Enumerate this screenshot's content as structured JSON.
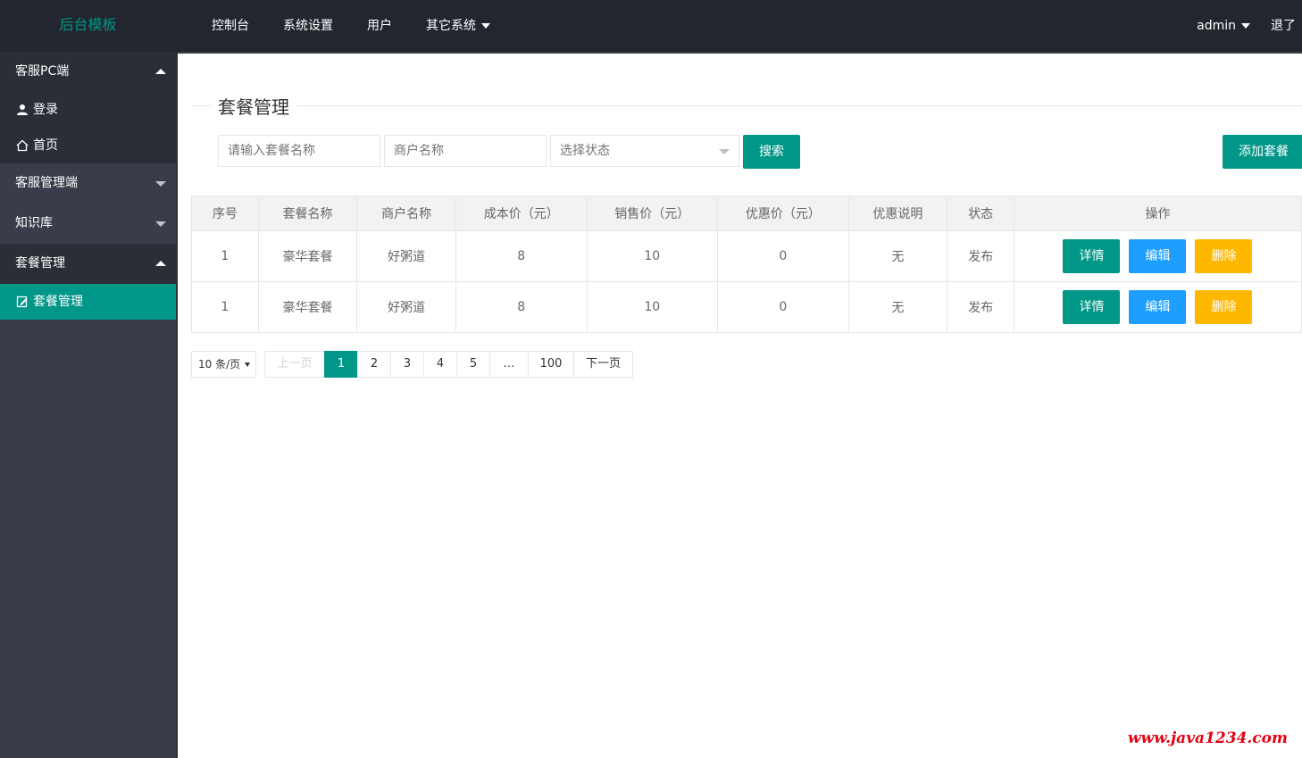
{
  "header": {
    "logo": "后台模板",
    "nav": [
      "控制台",
      "系统设置",
      "用户",
      "其它系统"
    ],
    "user": "admin",
    "logout": "退了"
  },
  "sidebar": {
    "groups": [
      {
        "title": "客服PC端",
        "expanded": true,
        "items": [
          {
            "label": "登录",
            "icon": "user-icon"
          },
          {
            "label": "首页",
            "icon": "home-icon"
          }
        ]
      },
      {
        "title": "客服管理端",
        "expanded": false
      },
      {
        "title": "知识库",
        "expanded": false
      },
      {
        "title": "套餐管理",
        "expanded": true,
        "items": [
          {
            "label": "套餐管理",
            "icon": "edit-icon",
            "selected": true
          }
        ]
      }
    ]
  },
  "main": {
    "title": "套餐管理",
    "search": {
      "package_placeholder": "请输入套餐名称",
      "merchant_placeholder": "商户名称",
      "status_placeholder": "选择状态",
      "search_button": "搜索",
      "add_button": "添加套餐"
    },
    "table": {
      "columns": [
        "序号",
        "套餐名称",
        "商户名称",
        "成本价（元）",
        "销售价（元）",
        "优惠价（元）",
        "优惠说明",
        "状态",
        "操作"
      ],
      "rows": [
        [
          "1",
          "豪华套餐",
          "好粥道",
          "8",
          "10",
          "0",
          "无",
          "发布"
        ],
        [
          "1",
          "豪华套餐",
          "好粥道",
          "8",
          "10",
          "0",
          "无",
          "发布"
        ]
      ],
      "actions": {
        "detail": "详情",
        "edit": "编辑",
        "delete": "删除"
      }
    },
    "pagination": {
      "limit": "10 条/页",
      "prev": "上一页",
      "pages": [
        "1",
        "2",
        "3",
        "4",
        "5",
        "…",
        "100"
      ],
      "current": "1",
      "next": "下一页"
    }
  },
  "watermark": "www.java1234.com",
  "colors": {
    "accent": "#009688",
    "blue": "#1e9fff",
    "orange": "#ffb800",
    "header": "#23262e",
    "sidebar": "#393d49"
  }
}
